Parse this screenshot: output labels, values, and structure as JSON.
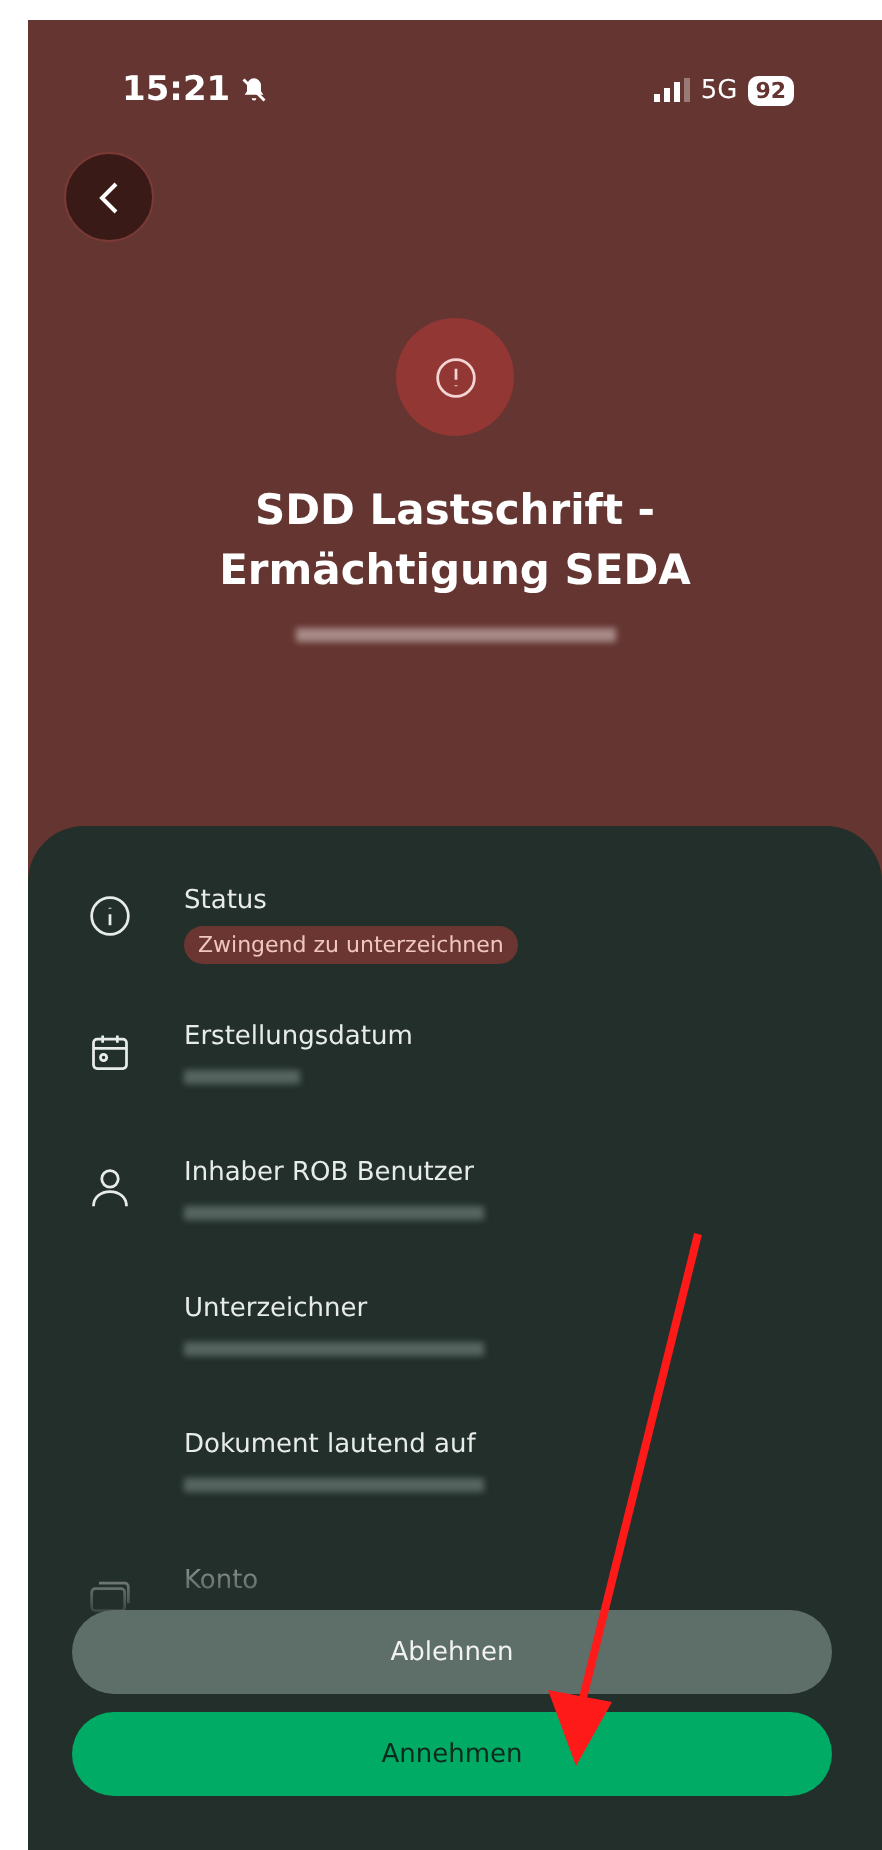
{
  "status_bar": {
    "time": "15:21",
    "network": "5G",
    "battery": "92"
  },
  "header": {
    "title": "SDD Lastschrift - Ermächtigung SEDA",
    "subtitle_redacted": true
  },
  "fields": [
    {
      "kind": "info",
      "label": "Status",
      "badge": "Zwingend zu unterzeichnen"
    },
    {
      "kind": "calendar",
      "label": "Erstellungsdatum",
      "value_redacted": true
    },
    {
      "kind": "person",
      "label": "Inhaber ROB Benutzer",
      "value_redacted": true
    },
    {
      "kind": "plain",
      "label": "Unterzeichner",
      "value_redacted": true
    },
    {
      "kind": "plain",
      "label": "Dokument lautend auf",
      "value_redacted": true
    },
    {
      "kind": "card",
      "label": "Konto"
    }
  ],
  "buttons": [
    {
      "kind": "secondary",
      "label": "Ablehnen"
    },
    {
      "kind": "primary",
      "label": "Annehmen"
    }
  ]
}
